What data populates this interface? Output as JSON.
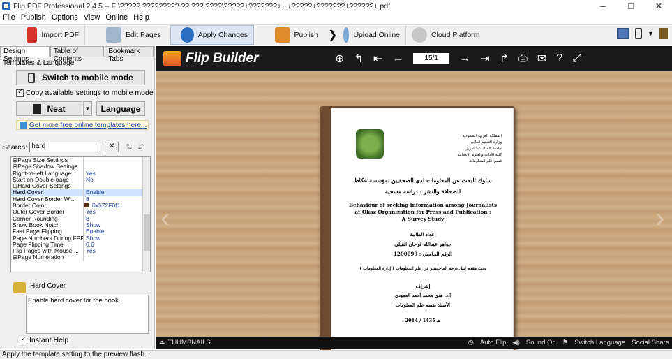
{
  "window": {
    "title": "Flip PDF Professional 2.4.5  -- F:\\????? ????????? ?? ??? ????\\?????+???????+...+?????+???????+??????+.pdf",
    "controls": [
      "–",
      "□",
      "✕"
    ]
  },
  "menu": [
    "File",
    "Publish",
    "Options",
    "View",
    "Online",
    "Help"
  ],
  "toolbar": {
    "import_pdf": "Import PDF",
    "edit_pages": "Edit Pages",
    "apply_changes": "Apply Changes",
    "publish": "Publish",
    "upload_online": "Upload Online",
    "cloud_platform": "Cloud Platform"
  },
  "left_panel": {
    "tabs": [
      "Design Settings",
      "Table of Contents",
      "Bookmark Tabs"
    ],
    "section": "Templates & Language",
    "switch_mobile": "Switch to mobile mode",
    "copy_settings": "Copy available settings to mobile mode",
    "template_name": "Neat",
    "language_button": "Language",
    "more_templates": "Get more free online templates here...",
    "search_label": "Search:",
    "search_value": "hard"
  },
  "properties": [
    {
      "k": "⊞Page Size Settings",
      "v": ""
    },
    {
      "k": "⊞Page Shadow Settings",
      "v": ""
    },
    {
      "k": "  Right-to-left Language",
      "v": "Yes"
    },
    {
      "k": "  Start on Double-page",
      "v": "No"
    },
    {
      "k": "⊟Hard Cover Settings",
      "v": ""
    },
    {
      "k": "    Hard Cover",
      "v": "Enable"
    },
    {
      "k": "    Hard Cover Border Wi...",
      "v": "8"
    },
    {
      "k": "    Border Color",
      "v": "0x572F0D"
    },
    {
      "k": "    Outer Cover Border",
      "v": "Yes"
    },
    {
      "k": "    Corner Rounding",
      "v": "8"
    },
    {
      "k": "    Show Book Notch",
      "v": "Show"
    },
    {
      "k": "  Fast Page Flipping",
      "v": "Enable"
    },
    {
      "k": "  Page Numbers During FPF",
      "v": "Show"
    },
    {
      "k": "  Page Flipping Time",
      "v": "0.6"
    },
    {
      "k": "  Flip Pages with Mouse ...",
      "v": "Yes"
    },
    {
      "k": "⊟Page Numeration",
      "v": ""
    }
  ],
  "description": {
    "title": "Hard Cover",
    "text": "Enable hard cover for the book.",
    "instant_help": "Instant Help"
  },
  "preview": {
    "brand": "Flip Builder",
    "page_indicator": "15/1",
    "thumbnails": "THUMBNAILS",
    "auto_flip": "Auto Flip",
    "sound_on": "Sound On",
    "switch_language": "Switch Language",
    "social_share": "Social Share"
  },
  "book_page": {
    "header_lines": [
      "المملكة العربية السعودية",
      "وزارة التعليم العالي",
      "جامعة الملك عبدالعزيز",
      "كلية الآداب والعلوم الإنسانية",
      "قسم علم المعلومات"
    ],
    "title_ar": "سلوك البحث عن المعلومات لدى الصحفيين بمؤسسة عكاظ",
    "subtitle_ar": "للصحافة والنشر : دراسة مسحية",
    "title_en_1": "Behaviour of seeking information among Journalists",
    "title_en_2": "at Okaz Organization for Press and Publication :",
    "title_en_3": "A Survey Study",
    "prepared": "إعداد الطالبة",
    "student": "جواهر عبدالله فرحان القيلي",
    "id_line": "الرقم الجامعي : 1200099",
    "degree": "بحث مقدم لنيل درجة الماجستير في علم المعلومات ( إدارة المعلومات )",
    "supervision": "إشراف",
    "supervisor": "أ.د. هدى محمد أحمد العمودي",
    "dept": "الأستاذ بقسم علم المعلومات",
    "date": "2014 / هـ 1435"
  },
  "status": "Apply the template setting to the preview flash..."
}
